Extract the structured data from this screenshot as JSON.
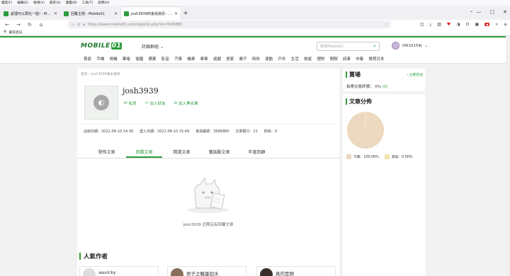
{
  "menubar": [
    "檔案(F)",
    "編輯(E)",
    "檢視(V)",
    "歷史(S)",
    "書籤(B)",
    "工具(T)",
    "說明(H)"
  ],
  "tabs": [
    {
      "title": "處理可以再吐一點! - Mobile01",
      "active": false
    },
    {
      "title": "回覆主題 - Mobile01",
      "active": false
    },
    {
      "title": "josh3939的會員資訊 - Mobile01",
      "active": true
    }
  ],
  "nav": {
    "url": "https://www.mobile01.com/replylist.php?id=3586880"
  },
  "bookmarks": {
    "label": "最常造訪"
  },
  "site": {
    "logo_text": "MOBILE",
    "logo_accent": "01",
    "forum_select": "討論群組",
    "search_placeholder": "搜尋Mobile01",
    "user_name": "l0632154j"
  },
  "categories": [
    "首頁",
    "手機",
    "相機",
    "筆電",
    "電腦",
    "蘋果",
    "影音",
    "汽車",
    "機車",
    "單車",
    "遊戲",
    "居家",
    "親子",
    "時尚",
    "運動",
    "戶外",
    "生活",
    "旅遊",
    "理財",
    "閒聊",
    "詩事",
    "市集",
    "微買日本"
  ],
  "profile": {
    "breadcrumb": "首頁 › josh3939基本資料",
    "username": "josh3939",
    "actions": [
      "私訊",
      "加入好友",
      "加入黑名單"
    ],
    "stats": [
      "註冊日期：2021-08-10 14:39",
      "登入日期：2021-08-10 15:49",
      "會員編號：3586880",
      "文章積分：21",
      "粉絲：0"
    ],
    "tabs": [
      "發佈文章",
      "回覆文章",
      "精選文章",
      "獲鼓勵文章",
      "年度回顧"
    ],
    "active_tab": 1,
    "empty_text": "josh3939 近期沒有回覆文章"
  },
  "popular": {
    "title": "人氣作者",
    "authors": [
      "aavicky",
      "君子之輪蛋如水",
      "真的是問"
    ]
  },
  "sidebar": {
    "shop_title": "賣場",
    "shop_link": "› 立即前往",
    "rating_label": "拍賣交易評價：",
    "rating_value": "0%",
    "rating_count": "(0)",
    "dist_title": "文章分佈"
  },
  "chart_data": {
    "type": "pie",
    "title": "文章分佈",
    "slices": [
      {
        "label": "汽車：100.00%",
        "value": 100.0,
        "color": "#edd9bf"
      },
      {
        "label": "其他：0.00%",
        "value": 0.0,
        "color": "#efe3a8"
      }
    ]
  }
}
